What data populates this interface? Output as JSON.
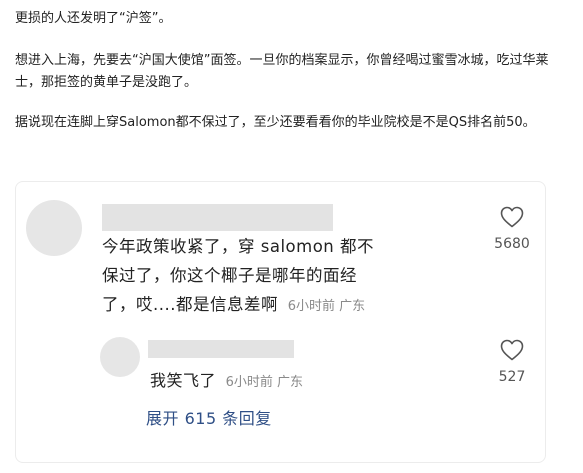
{
  "article": {
    "paragraphs": [
      "更损的人还发明了“沪签”。",
      "想进入上海，先要去“沪国大使馆”面签。一旦你的档案显示，你曾经喝过蜜雪冰城，吃过华莱士，那拒签的黄单子是没跑了。",
      "据说现在连脚上穿Salomon都不保过了，至少还要看看你的毕业院校是不是QS排名前50。"
    ]
  },
  "comment": {
    "text": "今年政策收紧了，穿 salomon 都不保过了，你这个椰子是哪年的面经了，哎....都是信息差啊",
    "time": "6小时前",
    "location": "广东",
    "likes": "5680"
  },
  "reply": {
    "text": "我笑飞了",
    "time": "6小时前",
    "location": "广东",
    "likes": "527"
  },
  "expand_label": "展开 615 条回复",
  "colors": {
    "link": "#2f4f86",
    "meta": "#8a8a8a",
    "placeholder": "#e3e3e3"
  },
  "icons": {
    "like": "heart-icon"
  }
}
